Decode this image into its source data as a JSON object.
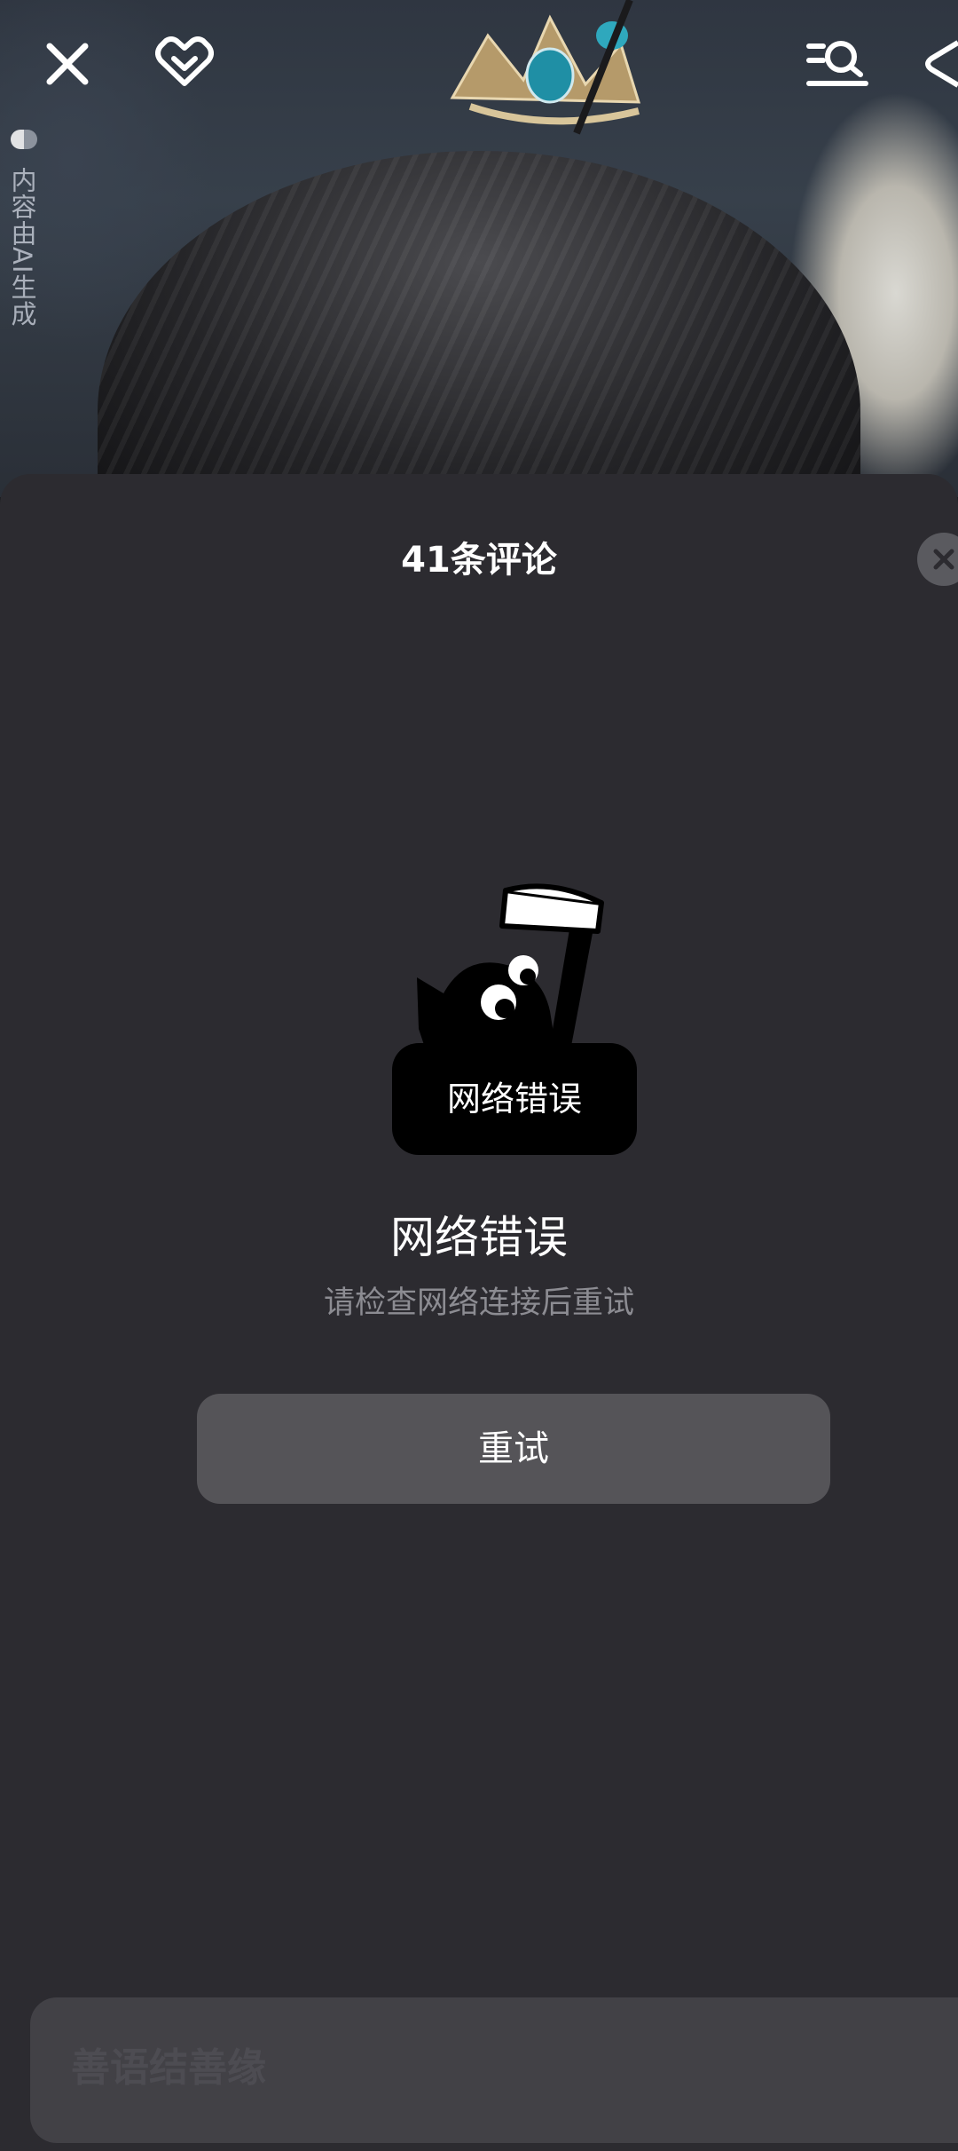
{
  "backdrop": {
    "ai_label": "内容由AI生成"
  },
  "top_bar": {
    "close_icon": "close-icon",
    "like_icon": "heart-check-icon",
    "search_icon": "search-list-icon",
    "share_icon": "share-icon"
  },
  "sheet": {
    "title": "41条评论",
    "close_icon": "close-icon"
  },
  "error": {
    "badge_text": "网络错误",
    "title": "网络错误",
    "subtitle": "请检查网络连接后重试",
    "retry_label": "重试"
  },
  "comment_input": {
    "placeholder": "善语结善缘"
  },
  "colors": {
    "sheet_bg": "#2c2b30",
    "button_bg": "#555458",
    "subtitle": "#8c8c92"
  }
}
